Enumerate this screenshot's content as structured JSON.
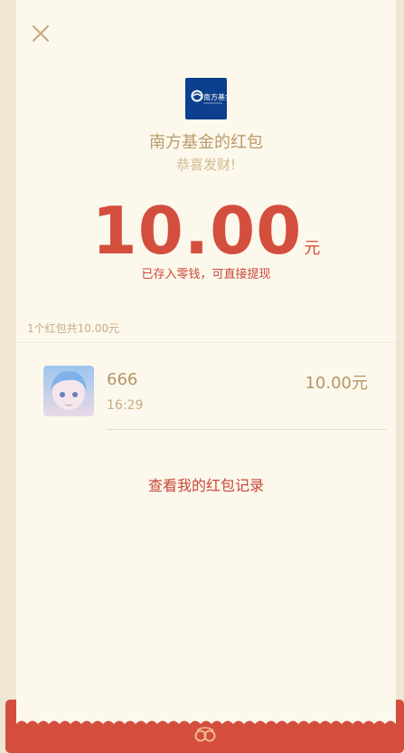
{
  "header": {
    "close_icon": "close-icon"
  },
  "sender": {
    "logo_text": "南方基金",
    "title": "南方基金的红包",
    "wish": "恭喜发财!"
  },
  "amount": {
    "value": "10.00",
    "unit": "元",
    "saved_note": "已存入零钱，可直接提现"
  },
  "summary": "1个红包共10.00元",
  "receivers": [
    {
      "name": "666",
      "time": "16:29",
      "amount": "10.00元"
    }
  ],
  "records_link": "查看我的红包记录",
  "colors": {
    "background": "#efe6d3",
    "card": "#fcf8ec",
    "accent_red": "#d44e3e",
    "gold": "#b99a6a",
    "logo_blue": "#0c3f8d"
  }
}
